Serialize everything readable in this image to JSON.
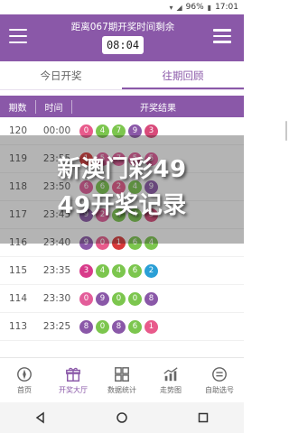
{
  "status": {
    "battery": "96%",
    "time": "17:01"
  },
  "header": {
    "title": "距离067期开奖时间剩余",
    "countdown": "08:04"
  },
  "tabs": [
    {
      "label": "今日开奖"
    },
    {
      "label": "往期回顾"
    }
  ],
  "table": {
    "headers": [
      "期数",
      "时间",
      "开奖结果"
    ],
    "rows": [
      {
        "issue": "120",
        "time": "00:00",
        "balls": [
          {
            "n": "0",
            "c": "#e85a8b"
          },
          {
            "n": "4",
            "c": "#7cc64e"
          },
          {
            "n": "7",
            "c": "#7cc64e"
          },
          {
            "n": "9",
            "c": "#8a58a8"
          },
          {
            "n": "3",
            "c": "#d94a7a"
          }
        ]
      },
      {
        "issue": "119",
        "time": "23:55",
        "balls": [
          {
            "n": "1",
            "c": "#d83a3a"
          },
          {
            "n": "5",
            "c": "#e35d9a"
          },
          {
            "n": "7",
            "c": "#e35d9a"
          },
          {
            "n": "5",
            "c": "#e35d9a"
          },
          {
            "n": "5",
            "c": "#e35d9a"
          }
        ]
      },
      {
        "issue": "118",
        "time": "23:50",
        "balls": [
          {
            "n": "6",
            "c": "#e35d9a"
          },
          {
            "n": "6",
            "c": "#7cc64e"
          },
          {
            "n": "2",
            "c": "#e85a8b"
          },
          {
            "n": "4",
            "c": "#7cc64e"
          },
          {
            "n": "9",
            "c": "#8a58a8"
          }
        ]
      },
      {
        "issue": "117",
        "time": "23:45",
        "balls": [
          {
            "n": "9",
            "c": "#8a58a8"
          },
          {
            "n": "2",
            "c": "#e35d9a"
          },
          {
            "n": "4",
            "c": "#7cc64e"
          },
          {
            "n": "4",
            "c": "#7cc64e"
          },
          {
            "n": "3",
            "c": "#d94a7a"
          }
        ]
      },
      {
        "issue": "116",
        "time": "23:40",
        "balls": [
          {
            "n": "9",
            "c": "#8a58a8"
          },
          {
            "n": "0",
            "c": "#e85a8b"
          },
          {
            "n": "1",
            "c": "#d83a3a"
          },
          {
            "n": "6",
            "c": "#7cc64e"
          },
          {
            "n": "4",
            "c": "#7cc64e"
          }
        ]
      },
      {
        "issue": "115",
        "time": "23:35",
        "balls": [
          {
            "n": "3",
            "c": "#d83a8a"
          },
          {
            "n": "4",
            "c": "#7cc64e"
          },
          {
            "n": "4",
            "c": "#7cc64e"
          },
          {
            "n": "6",
            "c": "#7cc64e"
          },
          {
            "n": "2",
            "c": "#2a9fd6"
          }
        ]
      },
      {
        "issue": "114",
        "time": "23:30",
        "balls": [
          {
            "n": "0",
            "c": "#e35d9a"
          },
          {
            "n": "9",
            "c": "#8a58a8"
          },
          {
            "n": "0",
            "c": "#7cc64e"
          },
          {
            "n": "0",
            "c": "#7cc64e"
          },
          {
            "n": "8",
            "c": "#8a58a8"
          }
        ]
      },
      {
        "issue": "113",
        "time": "23:25",
        "balls": [
          {
            "n": "8",
            "c": "#8a58a8"
          },
          {
            "n": "0",
            "c": "#7cc64e"
          },
          {
            "n": "8",
            "c": "#8a58a8"
          },
          {
            "n": "6",
            "c": "#7cc64e"
          },
          {
            "n": "1",
            "c": "#e85a8b"
          }
        ]
      }
    ]
  },
  "watermark": {
    "line1": "新澳门彩49",
    "line2": "49开奖记录"
  },
  "bottom_nav": [
    {
      "label": "首页",
      "icon": "compass-icon"
    },
    {
      "label": "开奖大厅",
      "icon": "gift-icon"
    },
    {
      "label": "数据统计",
      "icon": "grid-icon"
    },
    {
      "label": "走势图",
      "icon": "trend-icon"
    },
    {
      "label": "自助选号",
      "icon": "selector-icon"
    }
  ],
  "colors": {
    "accent": "#8a58a8"
  }
}
